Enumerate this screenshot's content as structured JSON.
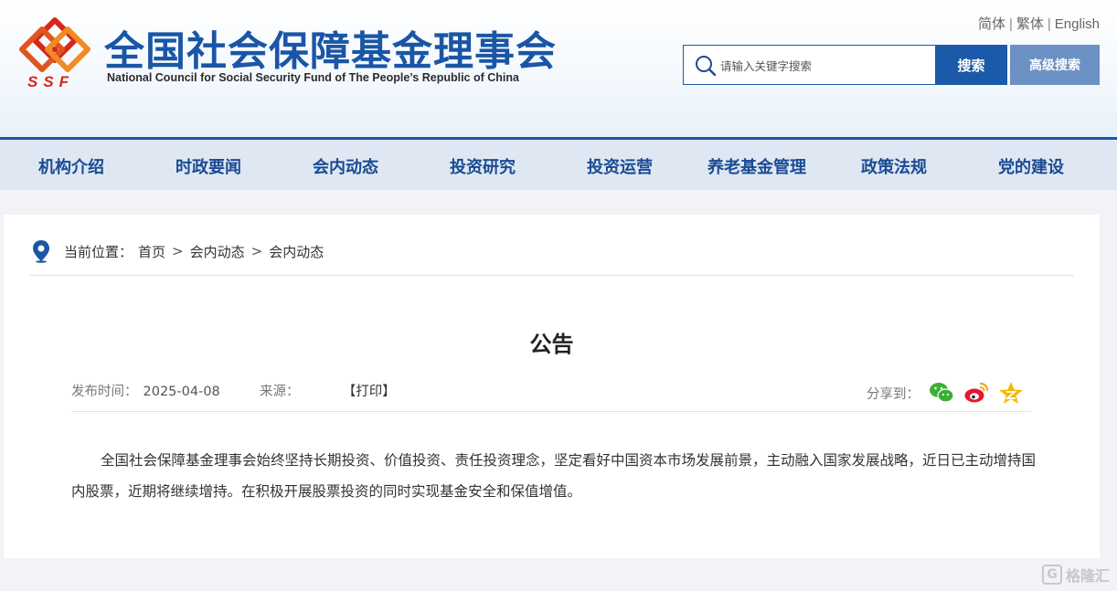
{
  "header": {
    "logo_text": "SSF",
    "title_cn": "全国社会保障基金理事会",
    "title_en": "National Council for Social Security Fund of The People’s Republic of China",
    "lang": [
      "简体",
      "繁体",
      "English"
    ],
    "search": {
      "placeholder": "请输入关键字搜索",
      "button": "搜索",
      "advanced": "高级搜索"
    }
  },
  "nav": [
    "机构介绍",
    "时政要闻",
    "会内动态",
    "投资研究",
    "投资运营",
    "养老基金管理",
    "政策法规",
    "党的建设"
  ],
  "breadcrumb": {
    "label": "当前位置：",
    "items": [
      "首页",
      "会内动态",
      "会内动态"
    ],
    "separator": ">"
  },
  "article": {
    "title": "公告",
    "publish_label": "发布时间：",
    "publish_date": "2025-04-08",
    "source_label": "来源：",
    "print": "【打印】",
    "share_label": "分享到：",
    "body": "全国社会保障基金理事会始终坚持长期投资、价值投资、责任投资理念，坚定看好中国资本市场发展前景，主动融入国家发展战略，近日已主动增持国内股票，近期将继续增持。在积极开展股票投资的同时实现基金安全和保值增值。"
  },
  "watermark": "格隆汇",
  "colors": {
    "brand_blue": "#1a56a6",
    "logo_red": "#d8261c",
    "nav_bg": "#dfe8f2",
    "adv_btn": "#6c91c5"
  }
}
